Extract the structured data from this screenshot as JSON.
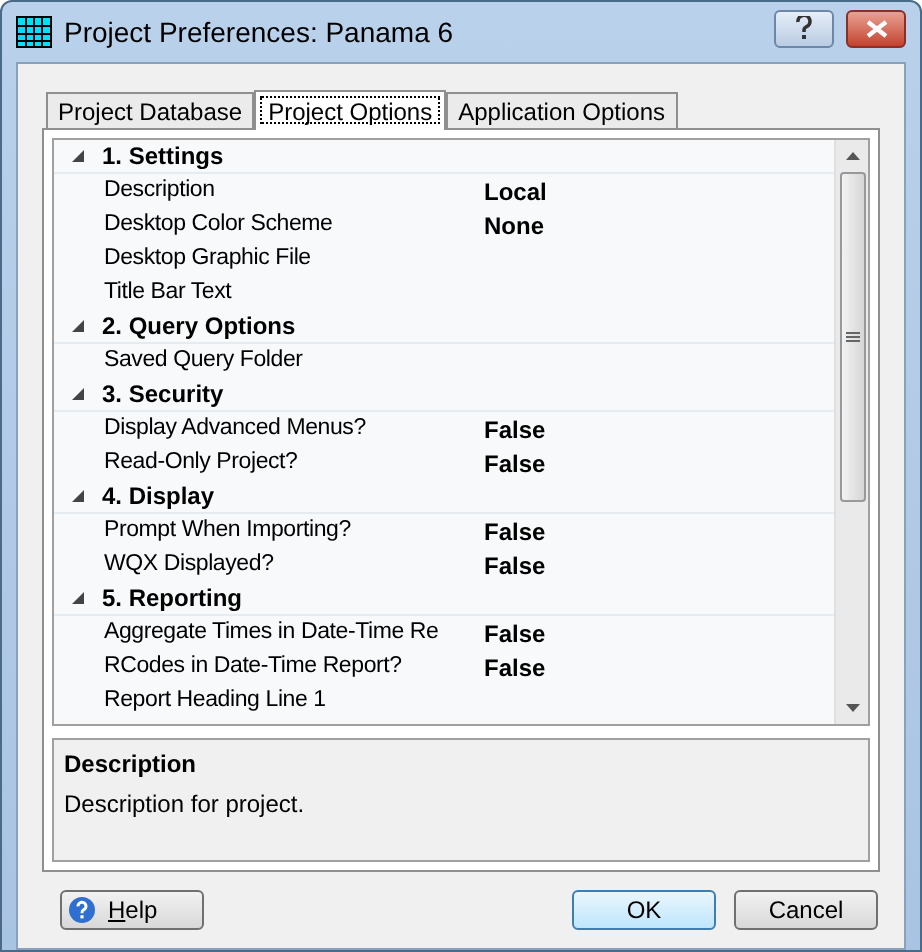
{
  "window": {
    "title": "Project Preferences: Panama 6"
  },
  "tabs": [
    {
      "label": "Project Database",
      "selected": false
    },
    {
      "label": "Project Options",
      "selected": true
    },
    {
      "label": "Application Options",
      "selected": false
    }
  ],
  "grid": {
    "categories": [
      {
        "title": "1. Settings",
        "expanded": true,
        "properties": [
          {
            "name": "Description",
            "value": "Local",
            "selected": false
          },
          {
            "name": "Desktop Color Scheme",
            "value": "None",
            "selected": false
          },
          {
            "name": "Desktop Graphic File",
            "selected": false
          },
          {
            "name": "Title Bar Text",
            "selected": false
          }
        ]
      },
      {
        "title": "2. Query Options",
        "expanded": true,
        "properties": [
          {
            "name": "Saved Query Folder",
            "selected": false
          }
        ]
      },
      {
        "title": "3. Security",
        "expanded": true,
        "properties": [
          {
            "name": "Display Advanced Menus?",
            "value": "False",
            "selected": false
          },
          {
            "name": "Read-Only Project?",
            "value": "False",
            "selected": false
          }
        ]
      },
      {
        "title": "4. Display",
        "expanded": true,
        "properties": [
          {
            "name": "Prompt When Importing?",
            "value": "False",
            "selected": false
          },
          {
            "name": "WQX Displayed?",
            "value": "False",
            "selected": false
          }
        ]
      },
      {
        "title": "5. Reporting",
        "expanded": true,
        "properties": [
          {
            "name": "Aggregate Times in Date-Time Re",
            "value": "False",
            "selected": false
          },
          {
            "name": "RCodes in Date-Time Report?",
            "value": "False",
            "selected": false
          },
          {
            "name": "Report Heading Line 1",
            "selected": false
          }
        ]
      }
    ]
  },
  "help_panel": {
    "title": "Description",
    "text": "Description for project."
  },
  "buttons": {
    "help": "Help",
    "ok": "OK",
    "cancel": "Cancel"
  }
}
